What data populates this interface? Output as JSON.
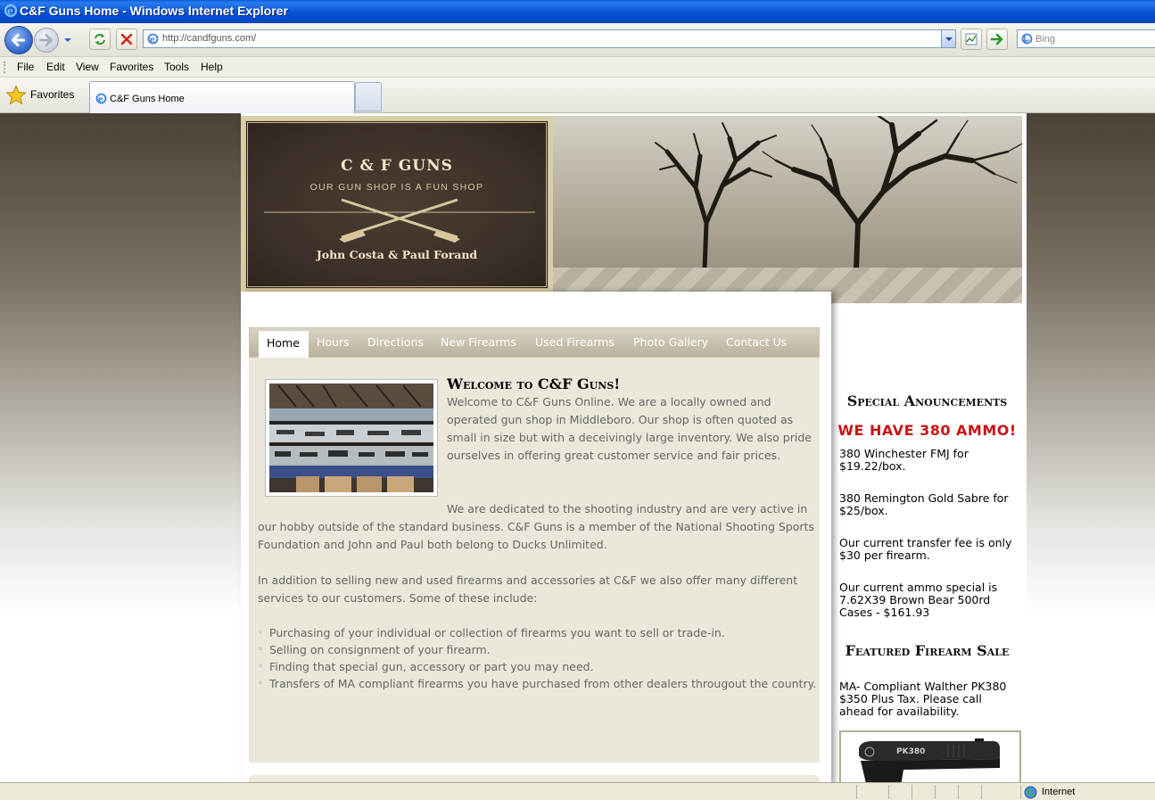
{
  "window": {
    "title": "C&F Guns Home - Windows Internet Explorer"
  },
  "address": {
    "url": "http://candfguns.com/"
  },
  "search": {
    "placeholder": "Bing"
  },
  "menu": [
    "File",
    "Edit",
    "View",
    "Favorites",
    "Tools",
    "Help"
  ],
  "favorites": {
    "label": "Favorites"
  },
  "tab": {
    "title": "C&F Guns Home"
  },
  "logo": {
    "title": "C & F GUNS",
    "subtitle": "OUR GUN SHOP IS A FUN SHOP",
    "owners": "John Costa & Paul Forand"
  },
  "nav": {
    "items": [
      "Home",
      "Hours",
      "Directions",
      "New Firearms",
      "Used Firearms",
      "Photo Gallery",
      "Contact Us"
    ],
    "active": "Home"
  },
  "content": {
    "title": "Welcome to C&F Guns!",
    "p1": "Welcome to C&F Guns Online.  We are a locally owned and operated gun shop in Middleboro.   Our shop is often quoted as small in size but with a deceivingly large inventory.  We also pride ourselves in offering great customer service and fair prices.",
    "p2": "We are dedicated to the shooting industry and are very active in our hobby outside of the standard business.  C&F Guns is a member of the National Shooting Sports Foundation and John and Paul both belong to Ducks Unlimited.",
    "p3": "In addition to selling new and used firearms and accessories at C&F we also offer many different services to our customers.  Some of these include:",
    "services": [
      "Purchasing of your individual or collection of firearms you want to sell or trade-in.",
      "Selling on consignment of your firearm.",
      "Finding that special gun, accessory or part you may need.",
      "Transfers of MA compliant firearms you have purchased from other dealers througout the country."
    ]
  },
  "sidebar": {
    "announcements_heading": "Special Anouncements",
    "ammo_heading": "WE HAVE 380 AMMO!",
    "items": [
      "380 Winchester FMJ for $19.22/box.",
      "380 Remington Gold Sabre for $25/box.",
      "Our current transfer fee is only $30 per firearm.",
      "Our current ammo special is 7.62X39 Brown Bear 500rd Cases - $161.93"
    ],
    "sale_heading": "Featured Firearm Sale",
    "sale_text": "MA- Compliant Walther PK380 $350 Plus Tax.  Please call ahead for availability.",
    "pistol_marking": "PK380"
  },
  "status": {
    "zone": "Internet"
  },
  "colors": {
    "accent_red": "#c81414",
    "nav_bg": "#b9b19c",
    "content_bg": "#ebe7db",
    "titlebar_blue": "#0b55d6"
  },
  "icons": [
    "ie-icon",
    "back-arrow-icon",
    "forward-arrow-icon",
    "refresh-icon",
    "stop-icon",
    "compatibility-icon",
    "go-arrow-icon",
    "bing-icon",
    "favorites-star-icon",
    "globe-icon"
  ]
}
